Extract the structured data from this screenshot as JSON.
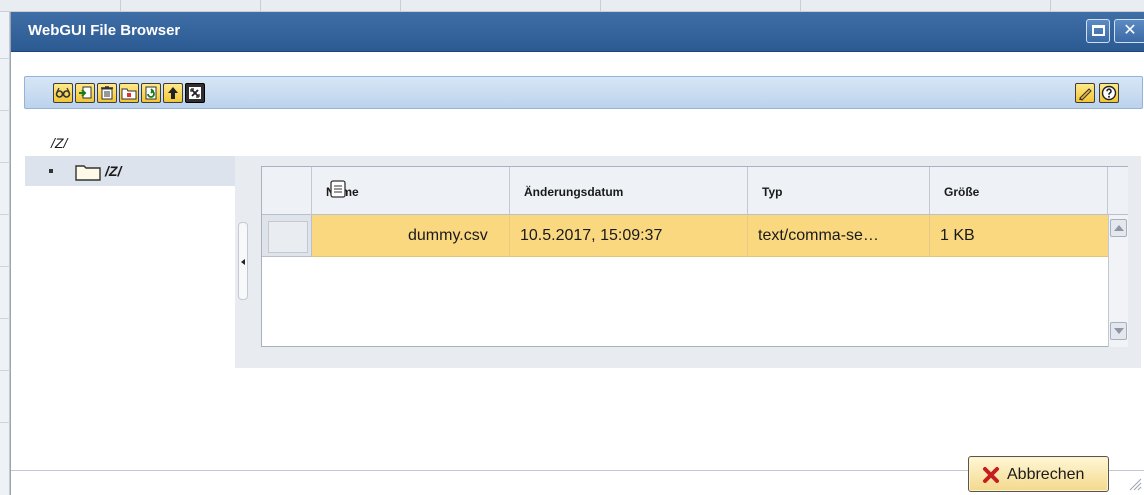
{
  "window": {
    "title": "WebGUI File Browser"
  },
  "toolbar": {
    "left_buttons": [
      "glasses-icon",
      "import-icon",
      "delete-icon",
      "new-folder-icon",
      "refresh-icon",
      "up-arrow-icon",
      "expand-icon"
    ],
    "right_buttons": [
      "edit-pencil-icon",
      "help-icon"
    ]
  },
  "path": "/Z/",
  "tree": {
    "root_label": "/Z/"
  },
  "table": {
    "columns": [
      "Name",
      "Änderungsdatum",
      "Typ",
      "Größe"
    ],
    "rows": [
      {
        "name": "dummy.csv",
        "modified": "10.5.2017, 15:09:37",
        "type": "text/comma-se…",
        "size": "1 KB"
      }
    ],
    "selected_row_color": "#fad880"
  },
  "footer": {
    "cancel_label": "Abbrechen"
  },
  "colors": {
    "titlebar": "#2c5a92",
    "toolbar": "#bcd3ec",
    "button_gold": "#f3c536"
  }
}
